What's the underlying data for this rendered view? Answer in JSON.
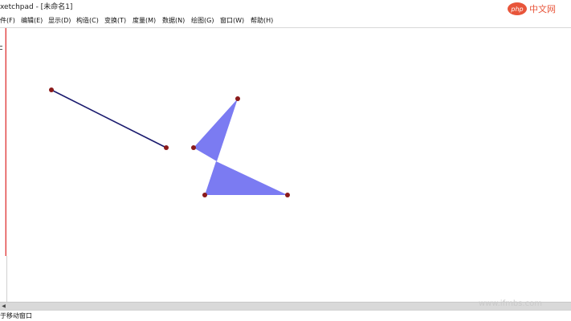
{
  "window": {
    "title": "xetchpad - [未命名1]"
  },
  "menu": {
    "items": [
      {
        "label": "件(F)"
      },
      {
        "label": "编辑(E)"
      },
      {
        "label": "显示(D)"
      },
      {
        "label": "构造(C)"
      },
      {
        "label": "变换(T)"
      },
      {
        "label": "度量(M)"
      },
      {
        "label": "数据(N)"
      },
      {
        "label": "绘图(G)"
      },
      {
        "label": "窗口(W)"
      },
      {
        "label": "帮助(H)"
      }
    ]
  },
  "status": {
    "text": "于移动窗口"
  },
  "watermark": {
    "logo": "php中文网",
    "url": "www.ifmbs.com"
  },
  "colors": {
    "segment": "#1a1a6e",
    "polygon_fill": "#7b7bf2",
    "point": "#8b1a1a",
    "toolbox_border": "#e04040"
  }
}
